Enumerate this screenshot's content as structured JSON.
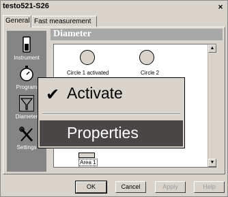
{
  "window": {
    "title": "testo521-S26",
    "close_glyph": "×"
  },
  "tabs": [
    {
      "label": "General",
      "selected": true
    },
    {
      "label": "Fast measurement",
      "selected": false
    }
  ],
  "sidebar": {
    "items": [
      {
        "label": "Instrument",
        "icon": "instrument-icon"
      },
      {
        "label": "Program",
        "icon": "stopwatch-icon"
      },
      {
        "label": "Diameter",
        "icon": "funnel-icon",
        "selected": true
      },
      {
        "label": "Settings",
        "icon": "tools-icon"
      }
    ]
  },
  "header": {
    "title": "Diameter"
  },
  "canvas": {
    "circles": [
      {
        "label": "Circle 1 activated"
      },
      {
        "label": "Circle 2"
      }
    ],
    "area_label": "Area 1"
  },
  "context_menu": {
    "items": [
      {
        "label": "Activate",
        "checked": true,
        "check_glyph": "✔"
      },
      {
        "label": "Properties",
        "highlighted": true
      }
    ]
  },
  "scrollbar": {
    "up_glyph": "▲",
    "down_glyph": "▼"
  },
  "buttons": {
    "ok": "OK",
    "cancel": "Cancel",
    "apply": "Apply",
    "help": "Help"
  },
  "colors": {
    "sidebar": "#858585",
    "header": "#a8a8a8",
    "menu_highlight": "#4a4646",
    "dialog": "#d8d4cc"
  }
}
